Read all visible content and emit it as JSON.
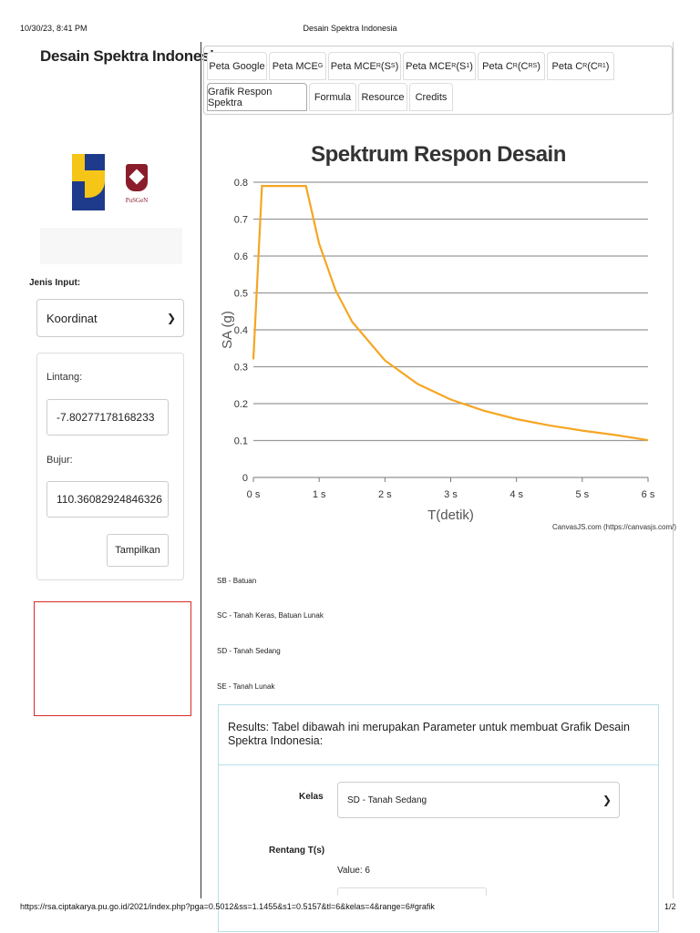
{
  "print": {
    "datetime": "10/30/23, 8:41 PM",
    "doc_title": "Desain Spektra Indonesia",
    "url": "https://rsa.ciptakarya.pu.go.id/2021/index.php?pga=0.5012&ss=1.1455&s1=0.5157&tl=6&kelas=4&range=6#grafik",
    "page": "1/2"
  },
  "sidebar": {
    "title": "Desain Spektra Indonesia",
    "logo_psg_text": "PuSGeN",
    "jenis_input_label": "Jenis Input:",
    "jenis_input_value": "Koordinat",
    "lintang_label": "Lintang:",
    "lintang_value": "-7.80277178168233",
    "bujur_label": "Bujur:",
    "bujur_value": "110.36082924846326",
    "tampilkan_label": "Tampilkan"
  },
  "tabs": {
    "google": "Peta Google",
    "mceg": "Peta MCE",
    "mceg_sub": "G",
    "mcer_ss": "Peta MCE",
    "mcer_ss_sub": "R",
    "mcer_ss_tail": " (S",
    "mcer_ss_sub2": "S",
    "mcer_s1": "Peta MCE",
    "mcer_s1_sub": "R",
    "mcer_s1_tail": " (S",
    "mcer_s1_sub2": "1",
    "crs": "Peta C",
    "crs_sub": "R",
    "crs_tail": " (C",
    "crs_sub2": "RS",
    "cr1": "Peta C",
    "cr1_sub": "R",
    "cr1_tail": " (C",
    "cr1_sub2": "R1",
    "close_paren": ")",
    "grafik": "Grafik Respon Spektra",
    "formula": "Formula",
    "resource": "Resource",
    "credits": "Credits"
  },
  "chart_data": {
    "type": "line",
    "title": "Spektrum Respon Desain",
    "xlabel": "T(detik)",
    "ylabel": "SA (g)",
    "xlim": [
      0,
      6
    ],
    "ylim": [
      0,
      0.8
    ],
    "x_ticks": [
      "0 s",
      "1 s",
      "2 s",
      "3 s",
      "4 s",
      "5 s",
      "6 s"
    ],
    "y_ticks": [
      "0",
      "0.1",
      "0.2",
      "0.3",
      "0.4",
      "0.5",
      "0.6",
      "0.7",
      "0.8"
    ],
    "grid": true,
    "color": "#f5a623",
    "series": [
      {
        "x": [
          0,
          0.13,
          0.65,
          0.8,
          1,
          1.25,
          1.5,
          2,
          2.5,
          3,
          3.5,
          4,
          4.5,
          5,
          5.5,
          6
        ],
        "y": [
          0.32,
          0.79,
          0.79,
          0.79,
          0.633,
          0.507,
          0.422,
          0.317,
          0.253,
          0.211,
          0.181,
          0.158,
          0.141,
          0.127,
          0.115,
          0.101
        ]
      }
    ],
    "credit": "CanvasJS.com (https://canvasjs.com/)"
  },
  "soil_legend": [
    "SB - Batuan",
    "SC - Tanah Keras, Batuan Lunak",
    "SD - Tanah Sedang",
    "SE - Tanah Lunak"
  ],
  "results": {
    "heading": "Results: Tabel dibawah ini merupakan Parameter untuk membuat Grafik Desain Spektra Indonesia:",
    "kelas_label": "Kelas",
    "kelas_value": "SD - Tanah Sedang",
    "rentang_label": "Rentang T(s)",
    "rentang_value": "Value: 6"
  }
}
